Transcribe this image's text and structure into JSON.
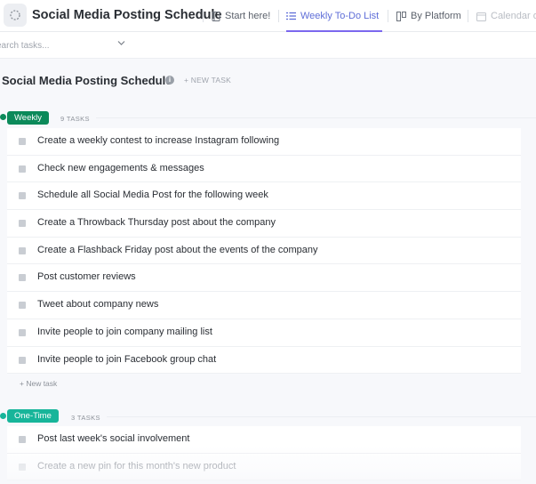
{
  "header": {
    "space_title": "Social Media Posting Schedule",
    "tabs": [
      {
        "label": "Start here!",
        "icon": "doc-icon"
      },
      {
        "label": "Weekly To-Do List",
        "icon": "list-icon",
        "active": true
      },
      {
        "label": "By Platform",
        "icon": "board-icon"
      },
      {
        "label": "Calendar o",
        "icon": "calendar-icon"
      }
    ]
  },
  "filter": {
    "search_placeholder": "earch tasks..."
  },
  "list": {
    "title": "Social Media Posting Schedule",
    "new_task_label": "+ NEW TASK"
  },
  "groups": [
    {
      "name": "Weekly",
      "count_label": "9 TASKS",
      "color": "#0c8a5a",
      "tasks": [
        "Create a weekly contest to increase Instagram following",
        "Check new engagements & messages",
        "Schedule all Social Media Post for the following week",
        "Create a Throwback Thursday post about the company",
        "Create a Flashback Friday post about the events of the company",
        "Post customer reviews",
        "Tweet about company news",
        "Invite people to join company mailing list",
        "Invite people to join Facebook group chat"
      ],
      "add_task_label": "+ New task"
    },
    {
      "name": "One-Time",
      "count_label": "3 TASKS",
      "color": "#17b59a",
      "tasks": [
        "Post last week's social involvement",
        "Create a new pin for this month's new product"
      ]
    }
  ]
}
